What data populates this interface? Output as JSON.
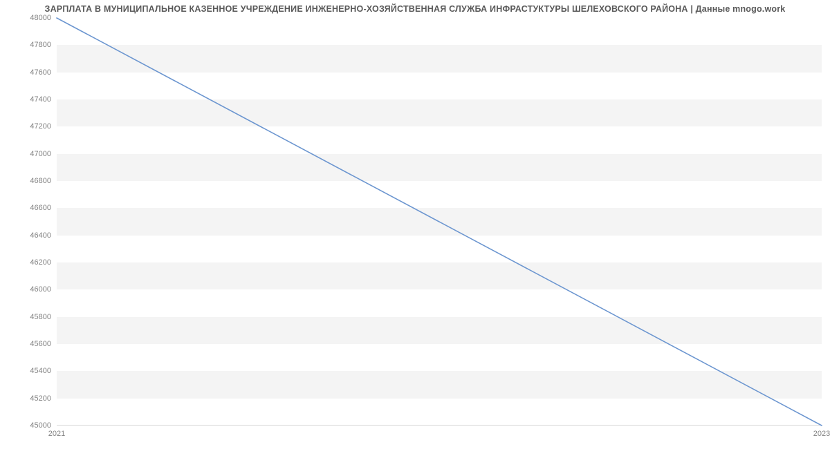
{
  "chart_data": {
    "type": "line",
    "title": "ЗАРПЛАТА В МУНИЦИПАЛЬНОЕ КАЗЕННОЕ УЧРЕЖДЕНИЕ ИНЖЕНЕРНО-ХОЗЯЙСТВЕННАЯ СЛУЖБА ИНФРАСТУКТУРЫ ШЕЛЕХОВСКОГО РАЙОНА | Данные mnogo.work",
    "x": [
      2021,
      2023
    ],
    "values": [
      48000,
      45000
    ],
    "x_ticks": [
      2021,
      2023
    ],
    "y_ticks": [
      45000,
      45200,
      45400,
      45600,
      45800,
      46000,
      46200,
      46400,
      46600,
      46800,
      47000,
      47200,
      47400,
      47600,
      47800,
      48000
    ],
    "xlabel": "",
    "ylabel": "",
    "ylim": [
      45000,
      48000
    ],
    "xlim": [
      2021,
      2023
    ],
    "line_color": "#6c96d0"
  }
}
